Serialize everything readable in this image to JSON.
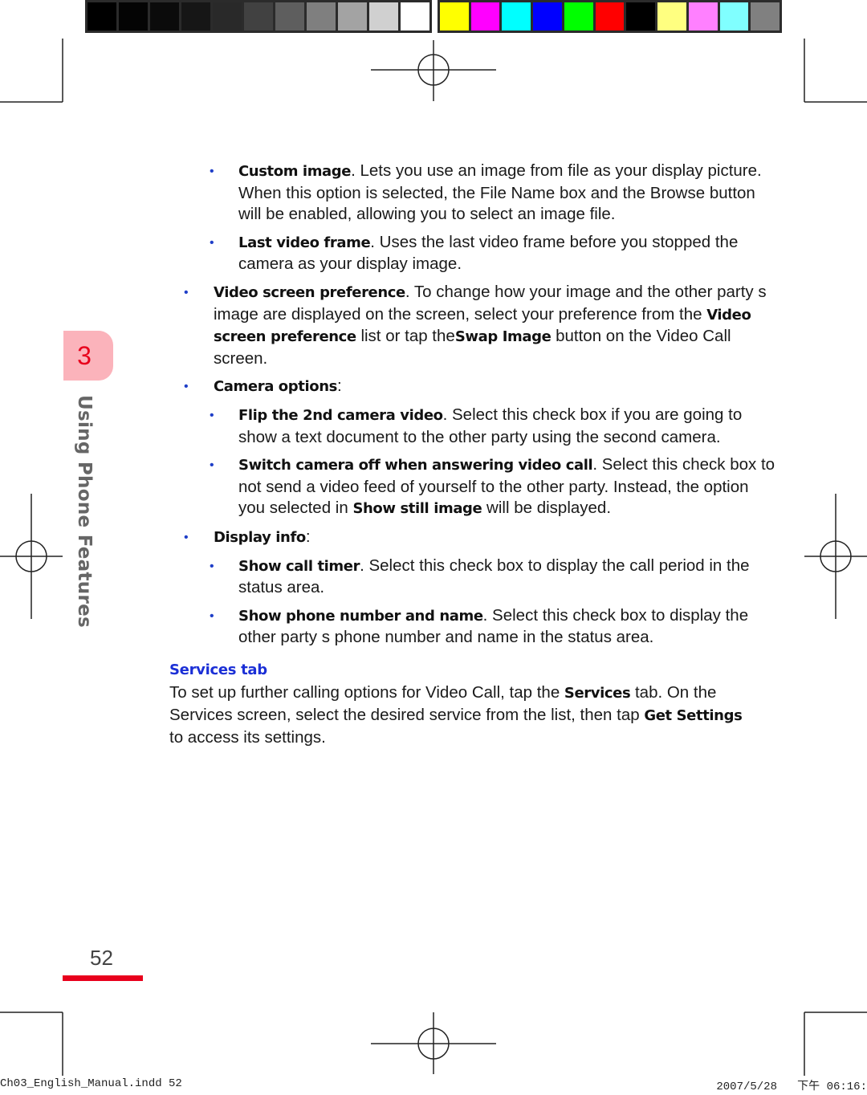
{
  "color_bars": {
    "grayscale": [
      "#000000",
      "#040404",
      "#0b0b0b",
      "#161616",
      "#292929",
      "#414141",
      "#5e5e5e",
      "#7f7f7f",
      "#a3a3a3",
      "#d0d0d0",
      "#ffffff"
    ],
    "colors": [
      "#ffff00",
      "#ff00ff",
      "#00ffff",
      "#0000ff",
      "#00ff00",
      "#ff0000",
      "#000000",
      "#ffff80",
      "#ff80ff",
      "#80ffff",
      "#808080"
    ]
  },
  "chapter": {
    "number": "3",
    "title": "Using Phone Features",
    "accent_color": "#e8001c",
    "tab_color": "#fbb3bb"
  },
  "content": {
    "items": [
      {
        "level": 2,
        "bold": "Custom image",
        "text": ". Lets you use an image from file as your display picture. When this option is selected, the File Name box and the Browse button will be enabled, allowing you to select an image file."
      },
      {
        "level": 2,
        "bold": "Last video frame",
        "text": ". Uses the last video frame before you stopped the camera as your display image."
      },
      {
        "level": 1,
        "bold": "Video screen preference",
        "text": ". To change how your image and the other party s image are displayed on the screen, select your preference from the ",
        "bold2": "Video screen preference",
        "text2": " list or tap the",
        "bold3": "Swap Image",
        "text3": " button on the Video Call screen."
      },
      {
        "level": 1,
        "bold": "Camera options",
        "text": ":"
      },
      {
        "level": 2,
        "bold": "Flip the 2nd camera video",
        "text": ". Select this check box if you are going to show a text document to the other party using the second camera."
      },
      {
        "level": 2,
        "bold": "Switch camera off when answering video call",
        "text": ". Select this check box to not send a video feed of yourself to the other party. Instead, the option you selected in ",
        "bold2": "Show still image",
        "text2": " will be displayed."
      },
      {
        "level": 1,
        "bold": "Display info",
        "text": ":"
      },
      {
        "level": 2,
        "bold": "Show call timer",
        "text": ". Select this check box to display the call period in the status area."
      },
      {
        "level": 2,
        "bold": "Show phone number and name",
        "text": ". Select this check box to display the other party s phone number and name in the status area."
      }
    ],
    "services": {
      "heading": "Services tab",
      "text1": "To set up further calling options for Video Call, tap the ",
      "bold1": "Services",
      "text2": " tab. On the Services screen, select the desired service from the list, then tap ",
      "bold2": "Get Settings",
      "text3": " to access its settings."
    }
  },
  "footer": {
    "page_number": "52",
    "slug_file": "Ch03_English_Manual.indd   52",
    "slug_date": "2007/5/28   下午 06:16:"
  }
}
